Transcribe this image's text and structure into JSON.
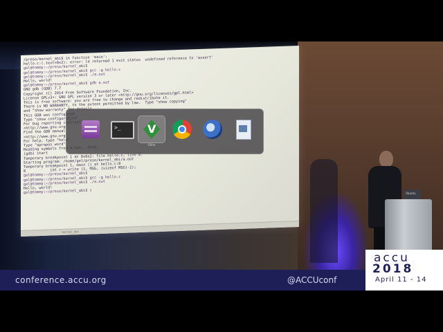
{
  "terminal": {
    "lines": [
      "/preso/kernel_abi$ in function 'main':",
      "hello.c:(.text+0x2): error: ld returned 1 exit status  undefined reference to 'assert'",
      "gel@tommy:~/preso/kernel_abi$",
      "gel@tommy:~/preso/kernel_abi$ gcc -g hello.c",
      "gel@tommy:~/preso/kernel_abi$ ./a.out",
      "Hello, world!",
      "gel@tommy:~/preso/kernel_abi$ gdb a.out",
      "GNU gdb (GDB) 7.7",
      "Copyright (C) 2014 Free Software Foundation, Inc.",
      "License GPLv3+: GNU GPL version 3 or later <http://gnu.org/licenses/gpl.html>",
      "This is free software: you are free to change and redistribute it.",
      "There is NO WARRANTY, to the extent permitted by law.  Type \"show copying\"",
      "and \"show warranty\" for details.",
      "This GDB was configured",
      "Type \"show configuration\"",
      "For bug reporting instructions",
      "<http://www.gnu.org",
      "Find the GDB manual",
      "<http://www.gnu.org",
      "For help, type \"help\"",
      "Type \"apropos word\"",
      "Reading symbols from a.out...done.",
      "(gdb) start",
      "Temporary breakpoint 1 at 0x6e2: file hello.c, line 8.",
      "Starting program: /home/gel/preso/kernel_abi/a.out",
      "",
      "Temporary breakpoint 1, main () at hello.c:8",
      "8           int r = write (1, MSG, (sizeof MSG)-1);",
      "gel@tommy:~/preso/kernel_abi$",
      "gel@tommy:~/preso/kernel_abi$ gcc -g hello.c",
      "gel@tommy:~/preso/kernel_abi$ ./a.out",
      "Hello, world!",
      "gel@tommy:~/preso/kernel_abi$ ▯"
    ]
  },
  "status_bar": {
    "left": "kernel_abi",
    "right": ""
  },
  "switcher": {
    "apps": [
      {
        "icon": "files-icon",
        "label": ""
      },
      {
        "icon": "terminal-icon",
        "label": ""
      },
      {
        "icon": "vim-icon",
        "label": "GVim"
      },
      {
        "icon": "chrome-icon",
        "label": ""
      },
      {
        "icon": "thunderbird-icon",
        "label": ""
      },
      {
        "icon": "document-viewer-icon",
        "label": ""
      }
    ],
    "selected_index": 2
  },
  "laptop": {
    "label": "Ubuntu"
  },
  "banner": {
    "left": "conference.accu.org",
    "right": "@ACCUconf"
  },
  "logo": {
    "name": "accu",
    "year": "2018",
    "dates": "April 11 - 14",
    "color": "#1e1f56"
  }
}
